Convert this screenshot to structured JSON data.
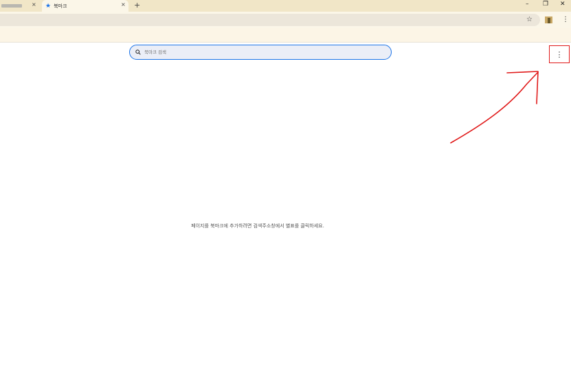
{
  "tabs": [
    {
      "label": "",
      "blurred": true
    },
    {
      "label": "북마크",
      "active": true
    }
  ],
  "tab_close_glyph": "×",
  "new_tab_glyph": "+",
  "window_controls": {
    "minimize": "–",
    "restore": "❐",
    "close": "✕"
  },
  "toolbar": {
    "bookmark_star": "☆",
    "menu": "⋮"
  },
  "page": {
    "search_placeholder": "북마크 검색",
    "menu_glyph": "⋮",
    "empty_message": "페이지를 북마크에 추가하려면 검색주소창에서 별표를 클릭하세요."
  },
  "colors": {
    "accent": "#1a73e8",
    "annotation": "#e01818",
    "tabstrip": "#f1e6c7"
  }
}
